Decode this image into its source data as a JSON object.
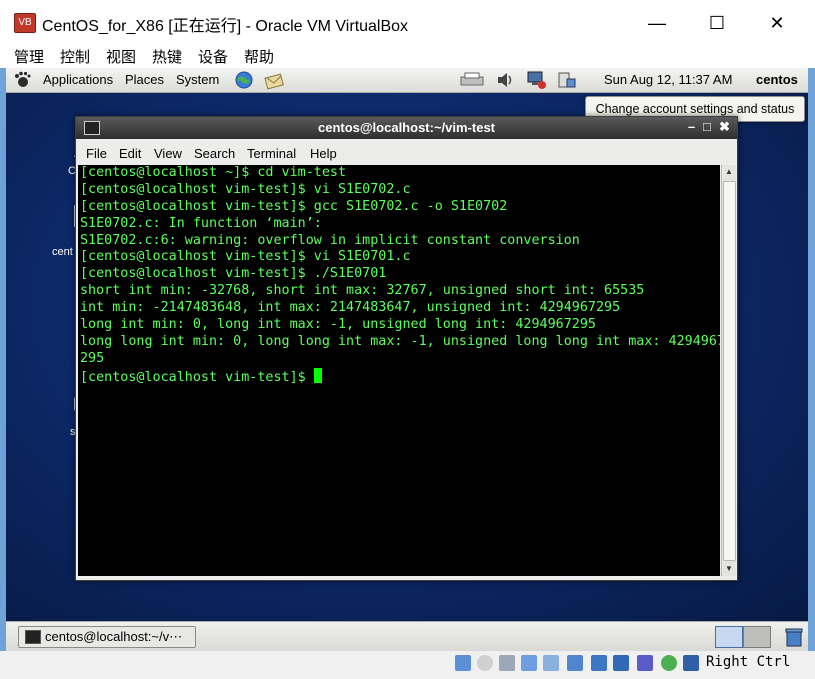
{
  "window": {
    "title": "CentOS_for_X86 [正在运行] - Oracle VM VirtualBox",
    "menu": [
      "管理",
      "控制",
      "视图",
      "热键",
      "设备",
      "帮助"
    ]
  },
  "gnome_panel": {
    "menus": [
      "Applications",
      "Places",
      "System"
    ],
    "clock": "Sun Aug 12, 11:37 AM",
    "user": "centos"
  },
  "tooltip": "Change account settings and status",
  "desktop": {
    "labels": [
      "C",
      "cent",
      "s"
    ]
  },
  "terminal": {
    "title": "centos@localhost:~/vim-test",
    "menu": [
      "File",
      "Edit",
      "View",
      "Search",
      "Terminal",
      "Help"
    ],
    "lines": [
      "[centos@localhost ~]$ cd vim-test",
      "[centos@localhost vim-test]$ vi S1E0702.c",
      "[centos@localhost vim-test]$ gcc S1E0702.c -o S1E0702",
      "S1E0702.c: In function ‘main’:",
      "S1E0702.c:6: warning: overflow in implicit constant conversion",
      "[centos@localhost vim-test]$ vi S1E0701.c",
      "[centos@localhost vim-test]$ ./S1E0701",
      "short int min: -32768, short int max: 32767, unsigned short int: 65535",
      "int min: -2147483648, int max: 2147483647, unsigned int: 4294967295",
      "long int min: 0, long int max: -1, unsigned long int: 4294967295",
      "long long int min: 0, long long int max: -1, unsigned long long int max: 4294967",
      "295"
    ],
    "prompt": "[centos@localhost vim-test]$ "
  },
  "taskbar": {
    "item": "centos@localhost:~/v⋯"
  },
  "statusbar": {
    "host_key": "Right Ctrl"
  },
  "icons": {
    "window_close": "✕",
    "window_maximize": "☐",
    "window_minimize": "—",
    "term_min": "–",
    "term_max": "□",
    "term_close": "✖"
  }
}
